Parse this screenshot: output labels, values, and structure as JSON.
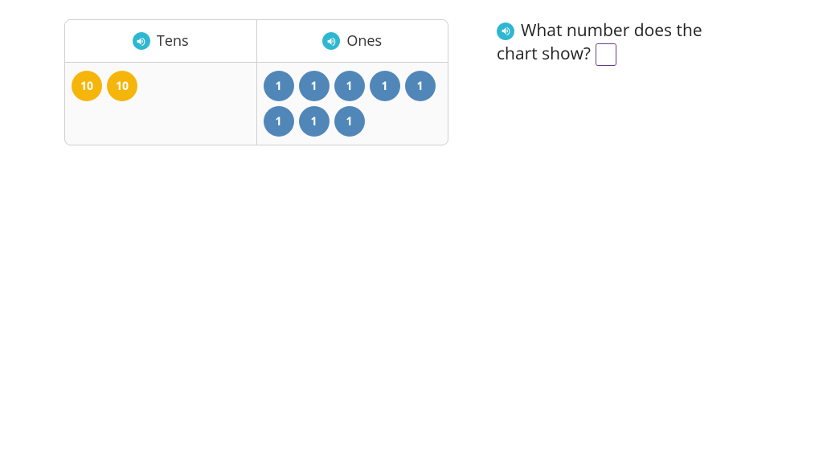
{
  "table": {
    "headers": {
      "tens": "Tens",
      "ones": "Ones"
    },
    "tens_disc_label": "10",
    "ones_disc_label": "1",
    "tens_count": 2,
    "ones_count": 8
  },
  "question": {
    "line1": "What number does the",
    "line2": "chart show?"
  },
  "answer": {
    "value": ""
  },
  "colors": {
    "tens_disc": "#f5b50a",
    "ones_disc": "#5087b8",
    "audio": "#2fb7d1",
    "input_border": "#6b3b8a"
  },
  "chart_data": {
    "type": "table",
    "title": "Place value chart",
    "columns": [
      "Tens",
      "Ones"
    ],
    "rows": [
      [
        2,
        8
      ]
    ],
    "represented_number": 28
  }
}
